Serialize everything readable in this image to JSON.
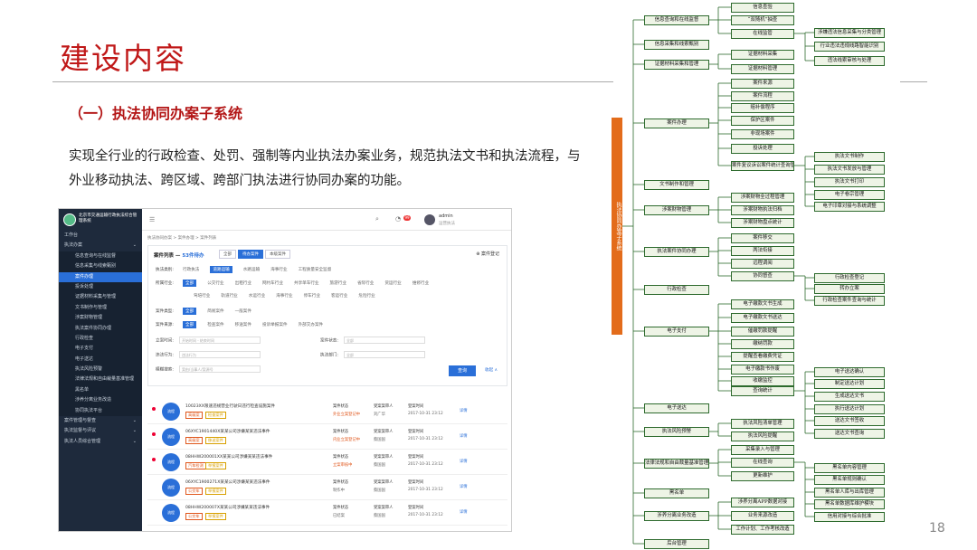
{
  "slide": {
    "title": "建设内容",
    "subtitle": "（一）执法协同办案子系统",
    "description": "实现全行业的行政检查、处罚、强制等内业执法办案业务，规范执法文书和执法流程，与外业移动执法、跨区域、跨部门执法进行协同办案的功能。",
    "page_number": "18"
  },
  "app": {
    "brand": "北京市交通运输行政执法综合管理系统",
    "sidebar": [
      "工作台",
      "执法办案",
      "信息查询与在线监督",
      "信息采集与线索甄别",
      "案件办理",
      "投诉处理",
      "证据材料采集与管理",
      "文书制作与管理",
      "涉案财物管理",
      "执法案件协同办理",
      "行政检查",
      "电子支付",
      "电子送达",
      "执法风险预警",
      "法律法规和自由裁量基准管理",
      "黑名单",
      "涉养分离业务改造",
      "协同执法平台",
      "案件管理与督查",
      "执法监督与评议",
      "执法人员综合管理"
    ],
    "user": {
      "name": "admin",
      "role": "运营执法",
      "badge": "99"
    },
    "breadcrumb": "执法协同办案 > 案件办理 > 案件列表",
    "panel": {
      "title": "案件列表",
      "count": "53件待办",
      "tabs": [
        "全部",
        "待办案件",
        "本级案件"
      ],
      "register": "案件登记",
      "rows": [
        {
          "label": "执法类别:",
          "opts": [
            "行政执法",
            "道路运输",
            "水路运输",
            "海事行业",
            "工程质量安全监督"
          ],
          "sel": 1
        },
        {
          "label": "所属行业:",
          "opts": [
            "全部",
            "公交行业",
            "出租行业",
            "网约车行业",
            "共享单车行业",
            "旅游行业",
            "省际行业",
            "货运行业",
            "维修行业"
          ],
          "sel": 0
        },
        {
          "label": "",
          "opts": [
            "驾培行业",
            "轨道行业",
            "水运行业",
            "海事行业",
            "停车行业",
            "客运行业",
            "危险行业"
          ],
          "sel": -1
        },
        {
          "label": "案件类型:",
          "opts": [
            "全部",
            "简易案件",
            "一般案件"
          ],
          "sel": 0
        },
        {
          "label": "案件来源:",
          "opts": [
            "全部",
            "检查案件",
            "移送案件",
            "投诉举报案件",
            "外部交办案件"
          ],
          "sel": 0
        }
      ],
      "filters": [
        {
          "label": "立案时间:",
          "ph": "开始时间 - 结束时间"
        },
        {
          "label": "案件状态:",
          "ph": "全部"
        },
        {
          "label": "违法行为:",
          "ph": "违法行为"
        },
        {
          "label": "执法部门:",
          "ph": "全部"
        },
        {
          "label": "模糊搜索:",
          "ph": "案由/当事人/案源号"
        }
      ],
      "query": "查询",
      "fold": "收起 ∧"
    },
    "cases": [
      {
        "name": "10023XX限速违规营业行驶日违行检查设施案件",
        "tags": [
          "高级案",
          "检查案件"
        ],
        "status": "案件状态",
        "state": "外业立案登记中",
        "party": "受案案审人",
        "who": "刘广华",
        "time": "登案时间",
        "date": "2017-10-31 23:12",
        "op": "详情",
        "dot": true
      },
      {
        "name": "06XYC1901440X某某公司涉嫌某某违法事件",
        "tags": [
          "高级案",
          "移送案件"
        ],
        "status": "案件状态",
        "state": "内业立案登记中",
        "party": "受案案审人",
        "who": "蔡国国",
        "time": "登案时间",
        "date": "2017-10-31 23:12",
        "op": "详情",
        "dot": true
      },
      {
        "name": "08HHW200001XX某某公司涉嫌某某违法事件",
        "tags": [
          "汽车检测",
          "举报案件"
        ],
        "status": "案件状态",
        "state": "立案审核中",
        "party": "受案案审人",
        "who": "蔡国国",
        "time": "登案时间",
        "date": "2017-10-31 23:12",
        "op": "详情",
        "dot": true
      },
      {
        "name": "06XYC1900271X某某公司涉嫌某某违法事件",
        "tags": [
          "公交车",
          "举报案件"
        ],
        "status": "案件状态",
        "state": "制作中",
        "party": "受案案审人",
        "who": "蔡国国",
        "time": "登案时间",
        "date": "2017-10-31 23:12",
        "op": "详情",
        "dot": false
      },
      {
        "name": "08HHW200007X某某公司涉嫌某某违法事件",
        "tags": [
          "公交车",
          "举报案件"
        ],
        "status": "案件状态",
        "state": "已结案",
        "party": "受案案审人",
        "who": "蔡国国",
        "time": "登案时间",
        "date": "2017-10-31 23:12",
        "op": "详情",
        "dot": false
      }
    ]
  },
  "tree": {
    "root": "执法协同办案子系统",
    "level1": [
      "信息查询和在线监督",
      "信息采集和线索甄别",
      "证据材料采集和管理",
      "案件办理",
      "文书制作和管理",
      "涉案财物管理",
      "执法案件协同办理",
      "行政检查",
      "电子支付",
      "电子送达",
      "执法风险预警",
      "法律法规和自由裁量基准管理",
      "黑名单",
      "涉养分离业务改造",
      "后台管理"
    ],
    "level2": [
      "信息查验",
      "“双随机”抽查",
      "在线监管",
      "证据材料采集",
      "证据材料管理",
      "案件来源",
      "案件流程",
      "赔补偿程序",
      "保护区案件",
      "非现场案件",
      "投诉处理",
      "案件复议诉讼案件统计查询管理",
      "涉案财物全过程管理",
      "涉案财物执法归档",
      "涉案财物盘点统计",
      "案件移交",
      "两法衔接",
      "远程调阅",
      "协同督查",
      "电子缴款文书生成",
      "电子缴款文书送达",
      "催缴罚款提醒",
      "缴纳罚款",
      "提醒查看缴费凭证",
      "电子缴款书作废",
      "收缴监控",
      "查询统计",
      "执法风险清单管理",
      "执法风险提醒",
      "采集录入与管理",
      "在线查询",
      "更新维护",
      "涉养分离APP数据对接",
      "业务来源改造",
      "工作计划、工作考核改造"
    ],
    "level3": [
      "涉嫌违法信息采集与分类管理",
      "行业违法违规线路智能识别",
      "违法线索审核与处理",
      "执法文书制作",
      "执法文书发放与管理",
      "执法文书打印",
      "电子卷宗管理",
      "电子印章对接与系统调整",
      "行政检查登记",
      "转办立案",
      "行政检查案件查询与统计",
      "电子送达确认",
      "制定送达计划",
      "生成送达文书",
      "执行送达计划",
      "送达文书签收",
      "送达文书查询",
      "黑名单内容管理",
      "黑名单规则确认",
      "黑名单人库与出库管理",
      "黑名单数据库维护模块",
      "信用对接与综合批准"
    ]
  }
}
